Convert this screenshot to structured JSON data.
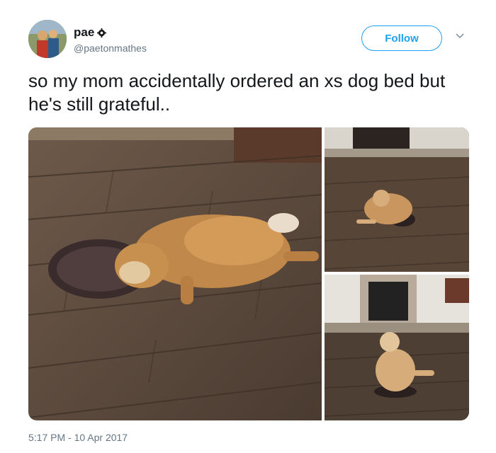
{
  "user": {
    "display_name": "pae",
    "handle": "@paetonmathes",
    "avatar_icon": "profile-photo",
    "name_badge_icon": "gear-icon"
  },
  "follow": {
    "label": "Follow",
    "accent_color": "#1da1f2"
  },
  "menu": {
    "caret_icon": "chevron-down-icon"
  },
  "tweet": {
    "text": "so my mom accidentally ordered an xs dog bed but he's still grateful..",
    "timestamp": "5:17 PM - 10 Apr 2017"
  },
  "media": {
    "photos": [
      {
        "description_icon": "dog-on-small-bed-photo"
      },
      {
        "description_icon": "dog-sitting-near-fireplace-photo"
      },
      {
        "description_icon": "dog-standing-on-small-bed-photo"
      }
    ]
  }
}
